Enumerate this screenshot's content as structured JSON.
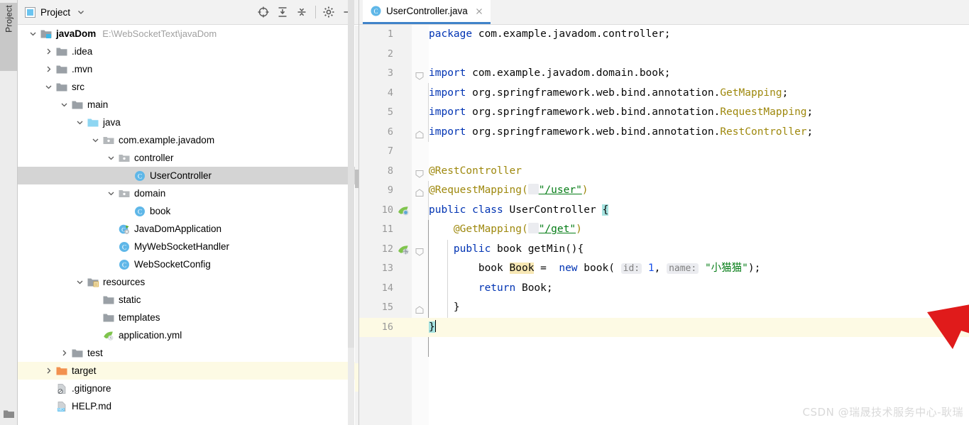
{
  "toolstrip": {
    "label": "Project",
    "folder_icon": "folder-icon"
  },
  "project_panel": {
    "title": "Project",
    "title_icon": "project-window-icon",
    "caret_icon": "chevron-down-icon",
    "tools": [
      {
        "name": "locate-target-icon",
        "title": "Select Opened File"
      },
      {
        "name": "expand-all-icon",
        "title": "Expand All"
      },
      {
        "name": "collapse-all-icon",
        "title": "Collapse All"
      },
      {
        "name": "gear-icon",
        "title": "Options"
      },
      {
        "name": "minimize-icon",
        "title": "Hide"
      }
    ],
    "tree": [
      {
        "label": "javaDom",
        "path": "E:\\WebSocketText\\javaDom",
        "depth": 0,
        "arrow": "down",
        "icon": "module-folder-icon",
        "bold": true,
        "state": "normal"
      },
      {
        "label": ".idea",
        "path": "",
        "depth": 1,
        "arrow": "right",
        "icon": "folder-icon",
        "bold": false,
        "state": "normal"
      },
      {
        "label": ".mvn",
        "path": "",
        "depth": 1,
        "arrow": "right",
        "icon": "folder-icon",
        "bold": false,
        "state": "normal"
      },
      {
        "label": "src",
        "path": "",
        "depth": 1,
        "arrow": "down",
        "icon": "folder-icon",
        "bold": false,
        "state": "normal"
      },
      {
        "label": "main",
        "path": "",
        "depth": 2,
        "arrow": "down",
        "icon": "folder-icon",
        "bold": false,
        "state": "normal"
      },
      {
        "label": "java",
        "path": "",
        "depth": 3,
        "arrow": "down",
        "icon": "source-root-icon",
        "bold": false,
        "state": "normal"
      },
      {
        "label": "com.example.javadom",
        "path": "",
        "depth": 4,
        "arrow": "down",
        "icon": "package-icon",
        "bold": false,
        "state": "normal"
      },
      {
        "label": "controller",
        "path": "",
        "depth": 5,
        "arrow": "down",
        "icon": "package-icon",
        "bold": false,
        "state": "normal"
      },
      {
        "label": "UserController",
        "path": "",
        "depth": 6,
        "arrow": "none",
        "icon": "java-class-icon",
        "bold": false,
        "state": "selected"
      },
      {
        "label": "domain",
        "path": "",
        "depth": 5,
        "arrow": "down",
        "icon": "package-icon",
        "bold": false,
        "state": "normal"
      },
      {
        "label": "book",
        "path": "",
        "depth": 6,
        "arrow": "none",
        "icon": "java-class-icon",
        "bold": false,
        "state": "normal"
      },
      {
        "label": "JavaDomApplication",
        "path": "",
        "depth": 5,
        "arrow": "none",
        "icon": "spring-boot-class-icon",
        "bold": false,
        "state": "normal"
      },
      {
        "label": "MyWebSocketHandler",
        "path": "",
        "depth": 5,
        "arrow": "none",
        "icon": "java-class-icon",
        "bold": false,
        "state": "normal"
      },
      {
        "label": "WebSocketConfig",
        "path": "",
        "depth": 5,
        "arrow": "none",
        "icon": "java-class-icon",
        "bold": false,
        "state": "normal"
      },
      {
        "label": "resources",
        "path": "",
        "depth": 3,
        "arrow": "down",
        "icon": "resource-root-icon",
        "bold": false,
        "state": "normal"
      },
      {
        "label": "static",
        "path": "",
        "depth": 4,
        "arrow": "none",
        "icon": "folder-icon",
        "bold": false,
        "state": "normal"
      },
      {
        "label": "templates",
        "path": "",
        "depth": 4,
        "arrow": "none",
        "icon": "folder-icon",
        "bold": false,
        "state": "normal"
      },
      {
        "label": "application.yml",
        "path": "",
        "depth": 4,
        "arrow": "none",
        "icon": "spring-yaml-icon",
        "bold": false,
        "state": "normal"
      },
      {
        "label": "test",
        "path": "",
        "depth": 2,
        "arrow": "right",
        "icon": "folder-icon",
        "bold": false,
        "state": "normal"
      },
      {
        "label": "target",
        "path": "",
        "depth": 1,
        "arrow": "right",
        "icon": "excluded-folder-icon",
        "bold": false,
        "state": "highlight"
      },
      {
        "label": ".gitignore",
        "path": "",
        "depth": 1,
        "arrow": "none",
        "icon": "gitignore-file-icon",
        "bold": false,
        "state": "normal"
      },
      {
        "label": "HELP.md",
        "path": "",
        "depth": 1,
        "arrow": "none",
        "icon": "markdown-file-icon",
        "bold": false,
        "state": "normal"
      }
    ]
  },
  "editor": {
    "tab": {
      "label": "UserController.java",
      "icon": "java-class-icon",
      "close_icon": "close-icon"
    },
    "current_line": 16,
    "lines": [
      {
        "n": 1,
        "gutter_icon": "",
        "fold": ""
      },
      {
        "n": 2,
        "gutter_icon": "",
        "fold": ""
      },
      {
        "n": 3,
        "gutter_icon": "",
        "fold": "fold-start"
      },
      {
        "n": 4,
        "gutter_icon": "",
        "fold": ""
      },
      {
        "n": 5,
        "gutter_icon": "",
        "fold": ""
      },
      {
        "n": 6,
        "gutter_icon": "",
        "fold": "fold-end"
      },
      {
        "n": 7,
        "gutter_icon": "",
        "fold": ""
      },
      {
        "n": 8,
        "gutter_icon": "",
        "fold": "fold-start"
      },
      {
        "n": 9,
        "gutter_icon": "",
        "fold": "fold-end"
      },
      {
        "n": 10,
        "gutter_icon": "spring-bean-icon",
        "fold": ""
      },
      {
        "n": 11,
        "gutter_icon": "",
        "fold": ""
      },
      {
        "n": 12,
        "gutter_icon": "spring-mapping-icon",
        "fold": "fold-start"
      },
      {
        "n": 13,
        "gutter_icon": "",
        "fold": ""
      },
      {
        "n": 14,
        "gutter_icon": "",
        "fold": ""
      },
      {
        "n": 15,
        "gutter_icon": "",
        "fold": "fold-end"
      },
      {
        "n": 16,
        "gutter_icon": "",
        "fold": ""
      }
    ],
    "code_text": {
      "l1": "package com.example.javadom.controller;",
      "l3": "import com.example.javadom.domain.book;",
      "l4": "import org.springframework.web.bind.annotation.GetMapping;",
      "l5": "import org.springframework.web.bind.annotation.RequestMapping;",
      "l6": "import org.springframework.web.bind.annotation.RestController;",
      "l8": "@RestController",
      "l9": "@RequestMapping(\"/user\")",
      "l10": "public class UserController {",
      "l11": "@GetMapping(\"/get\")",
      "l12": "public book getMin(){",
      "l13": "book Book =  new book( id: 1, name: \"小猫猫\");",
      "l14": "return Book;",
      "l15": "}",
      "l16": "}",
      "tok_package": "package",
      "tok_import": "import",
      "tok_public": "public",
      "tok_class": "class",
      "tok_new": "new",
      "tok_return": "return",
      "pkg_name": " com.example.javadom.controller;",
      "imp3": " com.example.javadom.domain.",
      "imp3_cls": "book",
      "imp_spring": " org.springframework.web.bind.annotation.",
      "cls_getmapping": "GetMapping",
      "cls_requestmapping": "RequestMapping",
      "cls_restcontroller": "RestController",
      "ann_rest": "@RestController",
      "ann_reqmap": "@RequestMapping(",
      "ann_getmap": "@GetMapping(",
      "str_user": "\"/user\"",
      "str_get": "\"/get\"",
      "paren_close": ")",
      "classname": " UserController ",
      "brace_open": "{",
      "brace_close": "}",
      "type_book": " book ",
      "var_book": "Book",
      "assign": " = ",
      "ctor": " book(",
      "hint_id": "id:",
      "num_one": "1",
      "comma": ", ",
      "hint_name": "name:",
      "str_cat": "\"小猫猫\"",
      "end_stmt": ");",
      "method_name": " getMin(){",
      "return_var": " Book;",
      "semi": ";"
    }
  },
  "annotation": {
    "arrow_color": "#e01b1b",
    "name": "red-pointer-arrow"
  },
  "watermark": {
    "text": "CSDN @瑞晟技术服务中心-耿瑞"
  },
  "colors": {
    "accent": "#4083c9",
    "keyword": "#0033b3",
    "annotation": "#9e880d",
    "string": "#067d17",
    "number": "#1750eb",
    "selection": "#a6e3e0",
    "current_line": "#fdfae4",
    "tree_selected": "#d4d4d4"
  }
}
